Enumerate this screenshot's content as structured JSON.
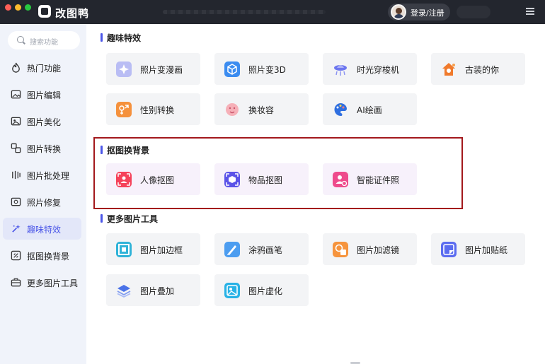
{
  "app": {
    "title": "改图鸭",
    "login_label": "登录/注册"
  },
  "colors": {
    "accent": "#4c57e8",
    "titlebar": "#23262e",
    "sidebar": "#f0f3fa",
    "highlight": "#a3181c"
  },
  "search": {
    "placeholder": "搜索功能"
  },
  "sidebar": {
    "items": [
      {
        "label": "热门功能",
        "icon": "fire-icon"
      },
      {
        "label": "图片编辑",
        "icon": "image-edit-icon"
      },
      {
        "label": "图片美化",
        "icon": "image-beautify-icon"
      },
      {
        "label": "图片转换",
        "icon": "convert-icon"
      },
      {
        "label": "图片批处理",
        "icon": "batch-icon"
      },
      {
        "label": "照片修复",
        "icon": "repair-icon"
      },
      {
        "label": "趣味特效",
        "icon": "sparkle-icon"
      },
      {
        "label": "抠图换背景",
        "icon": "cutout-icon"
      },
      {
        "label": "更多图片工具",
        "icon": "toolbox-icon"
      }
    ],
    "active_index": 6
  },
  "sections": [
    {
      "title": "趣味特效",
      "cards": [
        {
          "label": "照片变漫画",
          "icon": "comic-icon"
        },
        {
          "label": "照片变3D",
          "icon": "cube-3d-icon"
        },
        {
          "label": "时光穿梭机",
          "icon": "time-machine-icon"
        },
        {
          "label": "古装的你",
          "icon": "ancient-costume-icon"
        },
        {
          "label": "性别转换",
          "icon": "gender-swap-icon"
        },
        {
          "label": "换妆容",
          "icon": "makeup-icon"
        },
        {
          "label": "AI绘画",
          "icon": "ai-paint-icon"
        }
      ]
    },
    {
      "title": "抠图换背景",
      "cards": [
        {
          "label": "人像抠图",
          "icon": "portrait-cutout-icon"
        },
        {
          "label": "物品抠图",
          "icon": "object-cutout-icon"
        },
        {
          "label": "智能证件照",
          "icon": "id-photo-icon"
        }
      ]
    },
    {
      "title": "更多图片工具",
      "cards": [
        {
          "label": "图片加边框",
          "icon": "frame-icon"
        },
        {
          "label": "涂鸦画笔",
          "icon": "brush-icon"
        },
        {
          "label": "图片加滤镜",
          "icon": "filter-icon"
        },
        {
          "label": "图片加贴纸",
          "icon": "sticker-icon"
        },
        {
          "label": "图片叠加",
          "icon": "layers-icon"
        },
        {
          "label": "图片虚化",
          "icon": "blur-icon"
        }
      ]
    }
  ]
}
